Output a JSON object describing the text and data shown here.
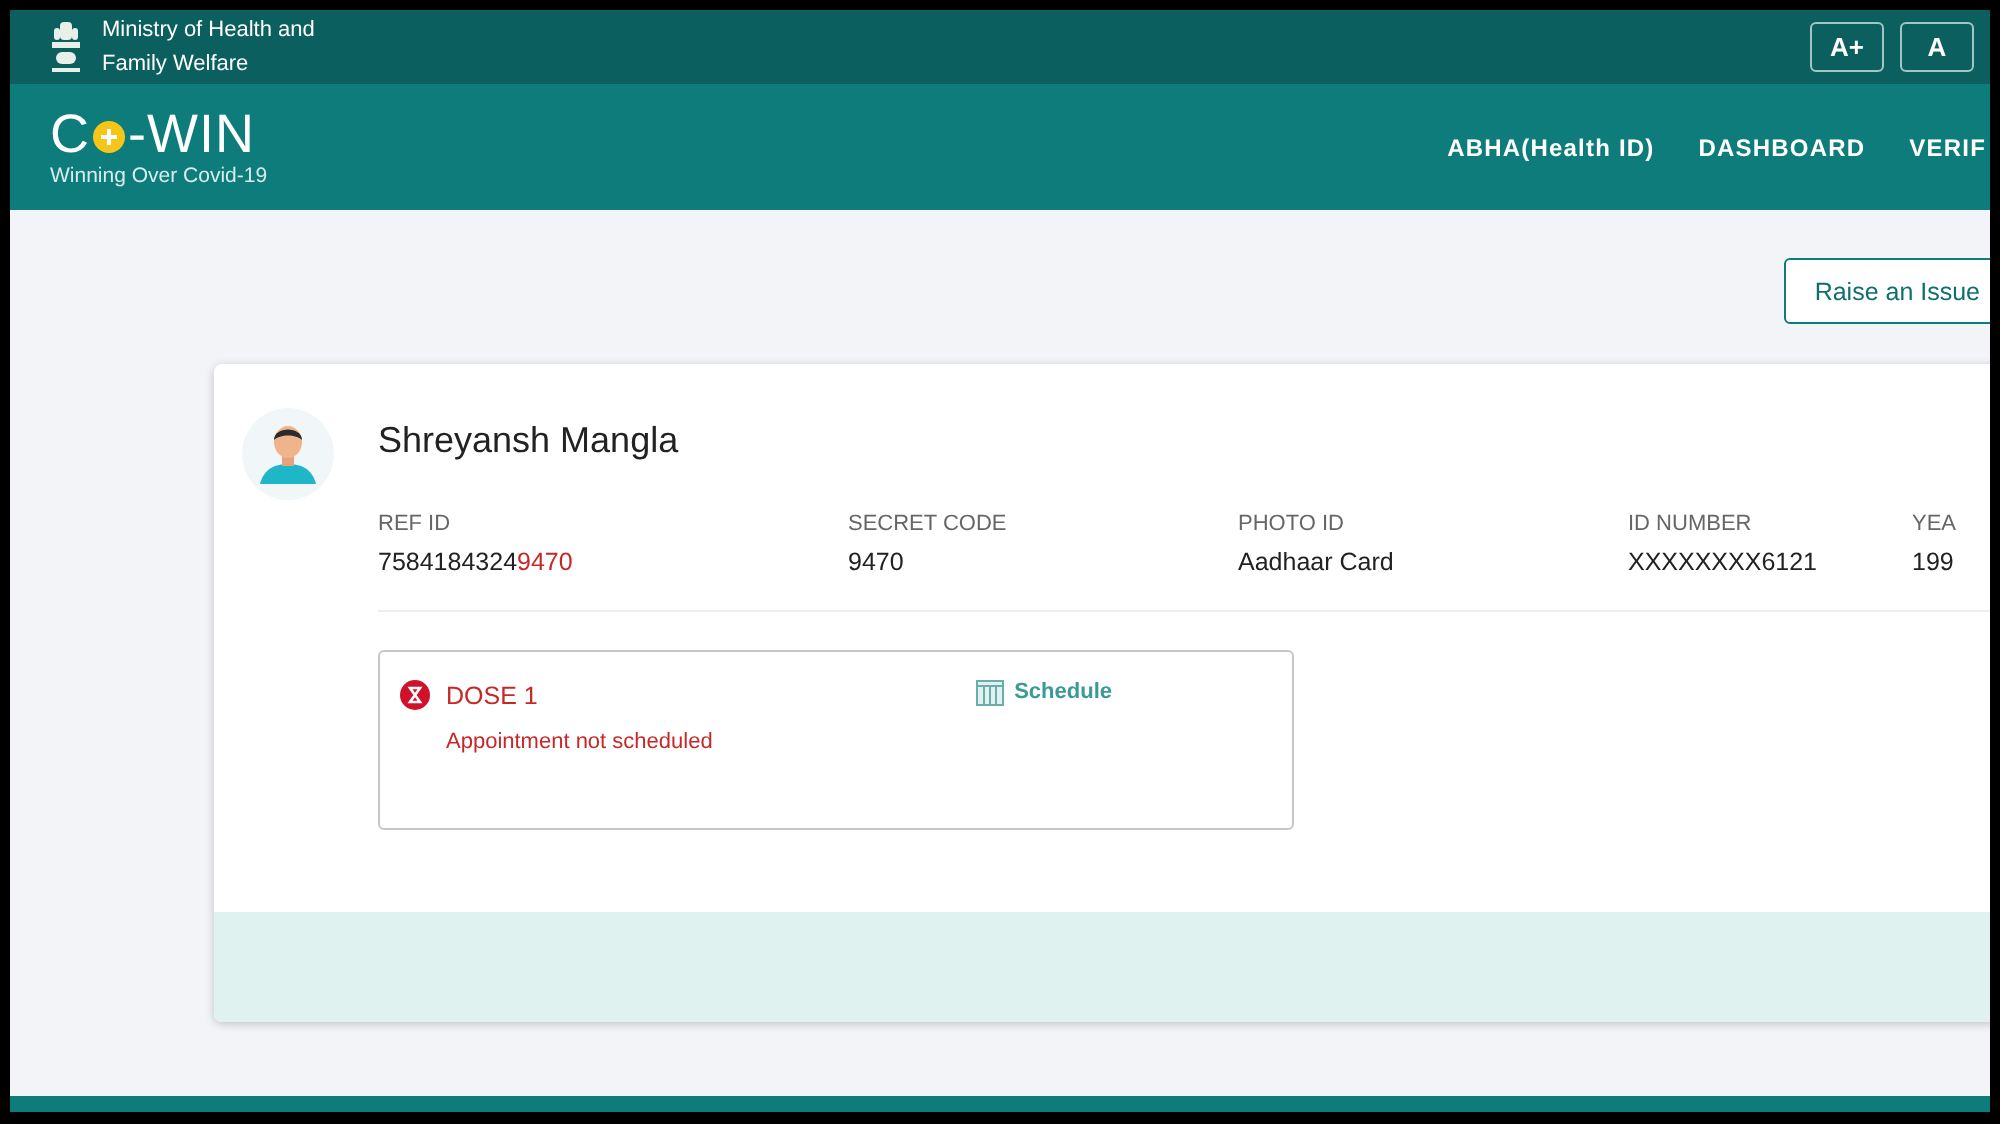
{
  "top_bar": {
    "ministry_lines": [
      "Ministry of Health and",
      "Family Welfare"
    ],
    "font_buttons": [
      "A+",
      "A"
    ]
  },
  "header": {
    "logo": {
      "first": "C",
      "rest": "-WIN",
      "tagline": "Winning Over Covid-19"
    },
    "nav": [
      "ABHA(Health ID)",
      "DASHBOARD",
      "VERIF"
    ]
  },
  "raise_issue": "Raise an Issue",
  "beneficiary": {
    "name": "Shreyansh Mangla",
    "fields": [
      {
        "label": "REF ID",
        "value": "7584184324",
        "highlight": "9470"
      },
      {
        "label": "SECRET CODE",
        "value": "9470"
      },
      {
        "label": "PHOTO ID",
        "value": "Aadhaar Card"
      },
      {
        "label": "ID NUMBER",
        "value": "XXXXXXXX6121"
      },
      {
        "label": "YEA",
        "value": "199"
      }
    ],
    "dose": {
      "title": "DOSE 1",
      "status": "Appointment not scheduled",
      "action": "Schedule",
      "scheduled": false
    }
  }
}
